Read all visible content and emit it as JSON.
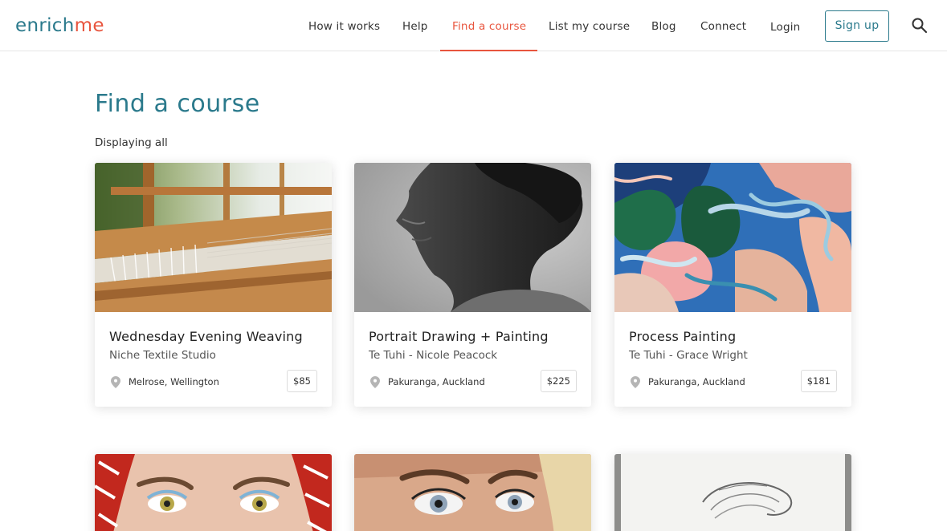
{
  "header": {
    "logo_part1": "enrich",
    "logo_part2": "me",
    "nav": [
      {
        "label": "How it works"
      },
      {
        "label": "Help"
      },
      {
        "label": "Find a course",
        "active": true
      },
      {
        "label": "List my course"
      },
      {
        "label": "Blog"
      },
      {
        "label": "Connect"
      },
      {
        "label": "Login"
      }
    ],
    "signup_label": "Sign up",
    "search_icon": "search-icon"
  },
  "main": {
    "title": "Find a course",
    "filter_status": "Displaying all",
    "courses": [
      {
        "title": "Wednesday Evening Weaving",
        "provider": "Niche Textile Studio",
        "location": "Melrose, Wellington",
        "price": "$85",
        "image": "weaving-loom-photo"
      },
      {
        "title": "Portrait Drawing + Painting",
        "provider": "Te Tuhi - Nicole Peacock",
        "location": "Pakuranga, Auckland",
        "price": "$225",
        "image": "charcoal-portrait"
      },
      {
        "title": "Process Painting",
        "provider": "Te Tuhi - Grace Wright",
        "location": "Pakuranga, Auckland",
        "price": "$181",
        "image": "abstract-painting"
      }
    ],
    "partial_cards": [
      {
        "image": "painted-eyes-red-headscarf"
      },
      {
        "image": "painted-eyes-portrait"
      },
      {
        "image": "pencil-sketch"
      }
    ]
  },
  "colors": {
    "brand_teal": "#2b7a8c",
    "brand_orange": "#e8553e"
  }
}
